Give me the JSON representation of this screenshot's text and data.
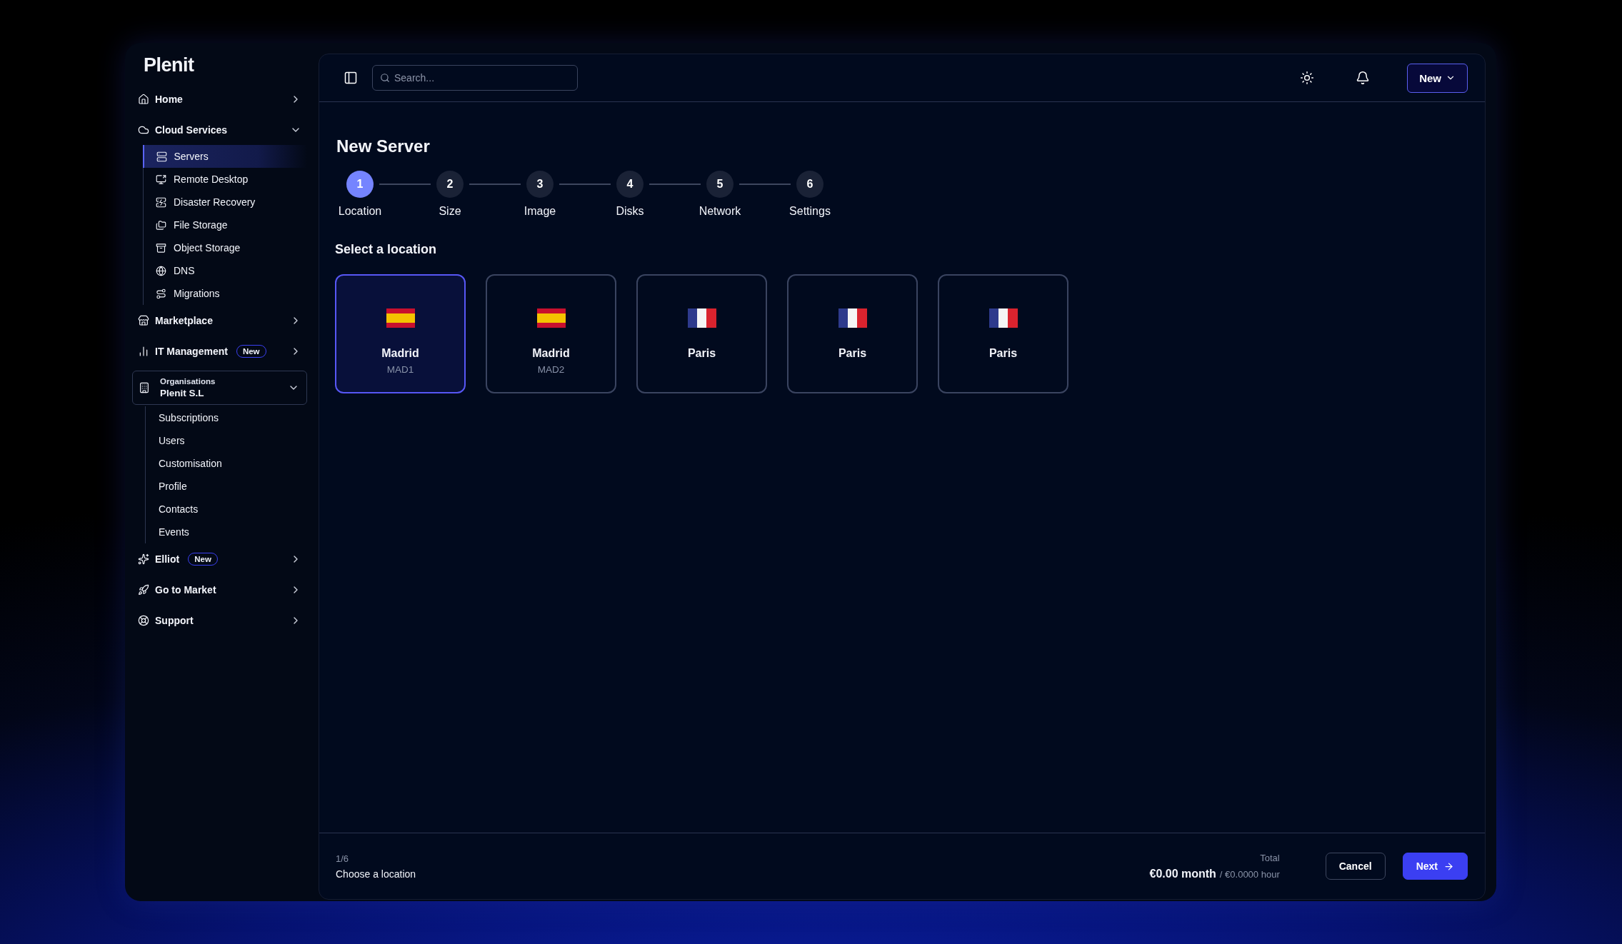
{
  "sidebar": {
    "logo": "Plenit",
    "items": [
      {
        "kind": "nav",
        "label": "Home",
        "expanded": false
      },
      {
        "kind": "nav",
        "label": "Cloud Services",
        "expanded": true,
        "children": [
          {
            "label": "Servers",
            "selected": true
          },
          {
            "label": "Remote Desktop",
            "selected": false
          },
          {
            "label": "Disaster Recovery",
            "selected": false
          },
          {
            "label": "File Storage",
            "selected": false
          },
          {
            "label": "Object Storage",
            "selected": false
          },
          {
            "label": "DNS",
            "selected": false
          },
          {
            "label": "Migrations",
            "selected": false
          }
        ]
      },
      {
        "kind": "nav",
        "label": "Marketplace",
        "expanded": false
      },
      {
        "kind": "nav",
        "label": "IT Management",
        "badge": "New",
        "expanded": false
      },
      {
        "kind": "org",
        "label": "Organisations",
        "value": "Plenit S.L",
        "expanded": true,
        "children": [
          {
            "label": "Subscriptions",
            "selected": false
          },
          {
            "label": "Users",
            "selected": false
          },
          {
            "label": "Customisation",
            "selected": false
          },
          {
            "label": "Profile",
            "selected": false
          },
          {
            "label": "Contacts",
            "selected": false
          },
          {
            "label": "Events",
            "selected": false
          }
        ]
      },
      {
        "kind": "nav",
        "label": "Elliot",
        "badge": "New",
        "expanded": false
      },
      {
        "kind": "nav",
        "label": "Go to Market",
        "expanded": false
      },
      {
        "kind": "nav",
        "label": "Support",
        "expanded": false
      }
    ]
  },
  "topbar": {
    "search": {
      "placeholder": "Search..."
    },
    "new_button": "New"
  },
  "page": {
    "title": "New Server",
    "steps": [
      {
        "number": "1",
        "label": "Location",
        "selected": true
      },
      {
        "number": "2",
        "label": "Size",
        "selected": false
      },
      {
        "number": "3",
        "label": "Image",
        "selected": false
      },
      {
        "number": "4",
        "label": "Disks",
        "selected": false
      },
      {
        "number": "5",
        "label": "Network",
        "selected": false
      },
      {
        "number": "6",
        "label": "Settings",
        "selected": false
      }
    ],
    "section_label": "Select a location",
    "locations": [
      {
        "kind": "es",
        "city": "Madrid",
        "code": "MAD1",
        "selected": true
      },
      {
        "kind": "es",
        "city": "Madrid",
        "code": "MAD2",
        "selected": false
      },
      {
        "kind": "fr",
        "city": "Paris",
        "selected": false
      },
      {
        "kind": "fr",
        "city": "Paris",
        "selected": false
      },
      {
        "kind": "fr",
        "city": "Paris",
        "selected": false
      }
    ]
  },
  "footer": {
    "step_count": "1/6",
    "hint": "Choose a location",
    "total_label": "Total",
    "price": "€0.00 month",
    "price_hourly": "/ €0.0000 hour",
    "buttons": [
      "Cancel",
      "Next"
    ]
  }
}
